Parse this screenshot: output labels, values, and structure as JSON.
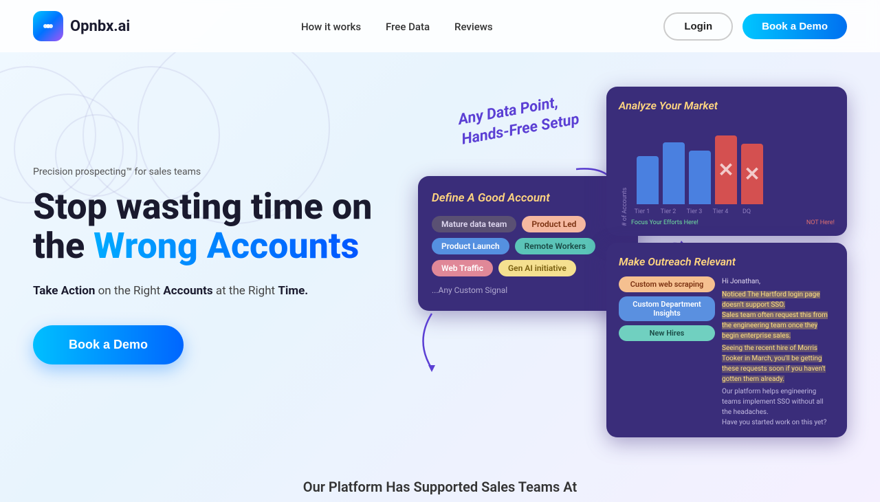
{
  "nav": {
    "logo_text": "Opnbx.ai",
    "logo_icon": "💬",
    "links": [
      {
        "label": "How it works",
        "id": "how-it-works"
      },
      {
        "label": "Free Data",
        "id": "free-data"
      },
      {
        "label": "Reviews",
        "id": "reviews"
      }
    ],
    "login_label": "Login",
    "demo_label": "Book a Demo"
  },
  "hero": {
    "tagline": "Precision prospecting™  for sales teams",
    "title_part1": "Stop wasting time on the ",
    "title_highlight": "Wrong Accounts",
    "subtitle_part1": "Take Action",
    "subtitle_part2": " on the Right ",
    "subtitle_bold1": "Accounts",
    "subtitle_part3": " at the Right ",
    "subtitle_bold2": "Time.",
    "cta_label": "Book a Demo"
  },
  "annotation": {
    "line1": "Any Data Point,",
    "line2": "Hands-Free Setup"
  },
  "card_define": {
    "title_plain": "Define A ",
    "title_italic": "Good Account",
    "tags": [
      {
        "label": "Mature data team",
        "style": "gray"
      },
      {
        "label": "Product Led",
        "style": "peach"
      },
      {
        "label": "Product Launch",
        "style": "blue"
      },
      {
        "label": "Remote Workers",
        "style": "teal"
      },
      {
        "label": "Web Traffic",
        "style": "pink"
      },
      {
        "label": "Gen AI initiative",
        "style": "yellow"
      }
    ],
    "more_label": "...Any Custom Signal"
  },
  "card_analyze": {
    "title_plain": "Analyze ",
    "title_italic": "Your Market",
    "y_label": "# of Accounts",
    "bars": [
      {
        "label": "Tier 1",
        "height": 70,
        "type": "blue"
      },
      {
        "label": "Tier 2",
        "height": 95,
        "type": "blue"
      },
      {
        "label": "Tier 3",
        "height": 80,
        "type": "blue"
      },
      {
        "label": "Tier 4",
        "height": 100,
        "type": "red"
      },
      {
        "label": "DQ",
        "height": 90,
        "type": "red"
      }
    ],
    "caption_left": "Focus Your Efforts Here!",
    "caption_right": "NOT Here!"
  },
  "card_outreach": {
    "title_plain": "Make Outreach ",
    "title_italic": "Relevant",
    "signals": [
      {
        "label": "Custom web scraping",
        "style": "peach"
      },
      {
        "label": "Custom Department Insights",
        "style": "blue"
      },
      {
        "label": "New Hires",
        "style": "teal"
      }
    ],
    "email": {
      "greeting": "Hi Jonathan,",
      "line1": "Noticed The Hartford login page doesn't support SSO.",
      "line2": "Sales team often request this from the engineering team once they begin enterprise sales.",
      "line3": "Seeing the recent hire of Morris Tooker in March, you'll be getting these requests soon if you haven't gotten them already.",
      "line4": "Our platform helps engineering teams implement SSO without all the headaches.",
      "line5": "Have you started work on this yet?"
    }
  },
  "bottom": {
    "text": "Our Platform Has Supported Sales Teams At"
  }
}
